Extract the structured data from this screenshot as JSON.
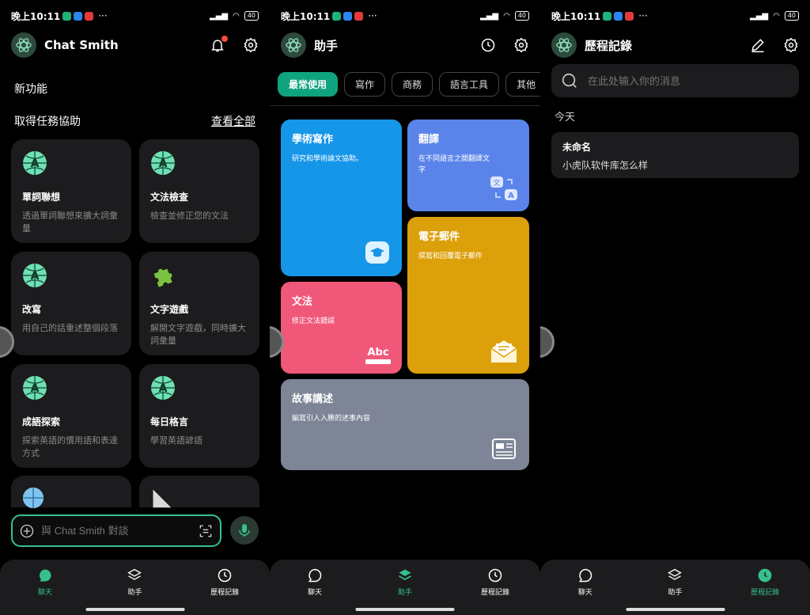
{
  "status": {
    "time": "晚上10:11",
    "battery": "40"
  },
  "colors": {
    "accent": "#35c08c",
    "chip_active": "#10a37f",
    "tile_academic": "#1696e8",
    "tile_translate": "#5b84eb",
    "tile_email": "#dca00a",
    "tile_grammar": "#f0587a",
    "tile_story": "#7d8596"
  },
  "screen1": {
    "title": "Chat Smith",
    "new_features": "新功能",
    "get_help": "取得任務協助",
    "view_all": "查看全部",
    "cards": [
      {
        "title": "單詞聯想",
        "desc": "透過單詞聯想來擴大詞彙量",
        "icon": "globe-a-icon"
      },
      {
        "title": "文法檢查",
        "desc": "檢查並修正您的文法",
        "icon": "globe-a-icon"
      },
      {
        "title": "改寫",
        "desc": "用自己的話重述整個段落",
        "icon": "globe-a-icon"
      },
      {
        "title": "文字遊戲",
        "desc": "解開文字遊戲，同時擴大詞彙量",
        "icon": "puzzle-icon"
      },
      {
        "title": "成語探索",
        "desc": "探索英語的慣用語和表達方式",
        "icon": "globe-a-icon"
      },
      {
        "title": "每日格言",
        "desc": "學習英語諺語",
        "icon": "globe-a-icon"
      }
    ],
    "input_placeholder": "與 Chat Smith 對談"
  },
  "screen2": {
    "title": "助手",
    "chips": [
      "最常使用",
      "寫作",
      "商務",
      "語言工具",
      "其他"
    ],
    "tiles": {
      "academic": {
        "title": "學術寫作",
        "desc": "研究和學術論文協助。"
      },
      "translate": {
        "title": "翻譯",
        "desc": "在不同語言之間翻譯文字"
      },
      "email": {
        "title": "電子郵件",
        "desc": "撰寫和回覆電子郵件"
      },
      "grammar": {
        "title": "文法",
        "desc": "修正文法錯誤",
        "icon_text": "Abc"
      },
      "story": {
        "title": "故事講述",
        "desc": "編寫引人入勝的述事內容"
      }
    }
  },
  "screen3": {
    "title": "歷程記錄",
    "search_placeholder": "在此处输入你的消息",
    "today": "今天",
    "entries": [
      {
        "title": "未命名",
        "subtitle": "小虎队软件库怎么样"
      }
    ]
  },
  "nav": {
    "chat": "聊天",
    "assistant": "助手",
    "history": "歷程記錄"
  }
}
